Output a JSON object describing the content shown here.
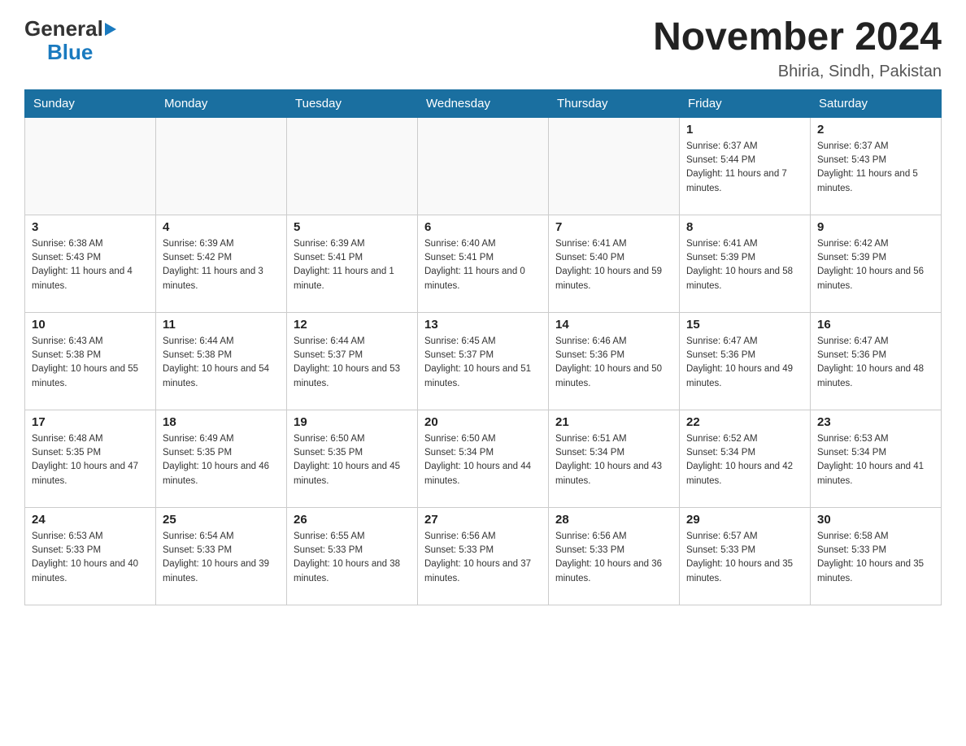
{
  "header": {
    "logo_general": "General",
    "logo_blue": "Blue",
    "month_year": "November 2024",
    "location": "Bhiria, Sindh, Pakistan"
  },
  "days_of_week": [
    "Sunday",
    "Monday",
    "Tuesday",
    "Wednesday",
    "Thursday",
    "Friday",
    "Saturday"
  ],
  "weeks": [
    [
      {
        "day": "",
        "info": ""
      },
      {
        "day": "",
        "info": ""
      },
      {
        "day": "",
        "info": ""
      },
      {
        "day": "",
        "info": ""
      },
      {
        "day": "",
        "info": ""
      },
      {
        "day": "1",
        "info": "Sunrise: 6:37 AM\nSunset: 5:44 PM\nDaylight: 11 hours and 7 minutes."
      },
      {
        "day": "2",
        "info": "Sunrise: 6:37 AM\nSunset: 5:43 PM\nDaylight: 11 hours and 5 minutes."
      }
    ],
    [
      {
        "day": "3",
        "info": "Sunrise: 6:38 AM\nSunset: 5:43 PM\nDaylight: 11 hours and 4 minutes."
      },
      {
        "day": "4",
        "info": "Sunrise: 6:39 AM\nSunset: 5:42 PM\nDaylight: 11 hours and 3 minutes."
      },
      {
        "day": "5",
        "info": "Sunrise: 6:39 AM\nSunset: 5:41 PM\nDaylight: 11 hours and 1 minute."
      },
      {
        "day": "6",
        "info": "Sunrise: 6:40 AM\nSunset: 5:41 PM\nDaylight: 11 hours and 0 minutes."
      },
      {
        "day": "7",
        "info": "Sunrise: 6:41 AM\nSunset: 5:40 PM\nDaylight: 10 hours and 59 minutes."
      },
      {
        "day": "8",
        "info": "Sunrise: 6:41 AM\nSunset: 5:39 PM\nDaylight: 10 hours and 58 minutes."
      },
      {
        "day": "9",
        "info": "Sunrise: 6:42 AM\nSunset: 5:39 PM\nDaylight: 10 hours and 56 minutes."
      }
    ],
    [
      {
        "day": "10",
        "info": "Sunrise: 6:43 AM\nSunset: 5:38 PM\nDaylight: 10 hours and 55 minutes."
      },
      {
        "day": "11",
        "info": "Sunrise: 6:44 AM\nSunset: 5:38 PM\nDaylight: 10 hours and 54 minutes."
      },
      {
        "day": "12",
        "info": "Sunrise: 6:44 AM\nSunset: 5:37 PM\nDaylight: 10 hours and 53 minutes."
      },
      {
        "day": "13",
        "info": "Sunrise: 6:45 AM\nSunset: 5:37 PM\nDaylight: 10 hours and 51 minutes."
      },
      {
        "day": "14",
        "info": "Sunrise: 6:46 AM\nSunset: 5:36 PM\nDaylight: 10 hours and 50 minutes."
      },
      {
        "day": "15",
        "info": "Sunrise: 6:47 AM\nSunset: 5:36 PM\nDaylight: 10 hours and 49 minutes."
      },
      {
        "day": "16",
        "info": "Sunrise: 6:47 AM\nSunset: 5:36 PM\nDaylight: 10 hours and 48 minutes."
      }
    ],
    [
      {
        "day": "17",
        "info": "Sunrise: 6:48 AM\nSunset: 5:35 PM\nDaylight: 10 hours and 47 minutes."
      },
      {
        "day": "18",
        "info": "Sunrise: 6:49 AM\nSunset: 5:35 PM\nDaylight: 10 hours and 46 minutes."
      },
      {
        "day": "19",
        "info": "Sunrise: 6:50 AM\nSunset: 5:35 PM\nDaylight: 10 hours and 45 minutes."
      },
      {
        "day": "20",
        "info": "Sunrise: 6:50 AM\nSunset: 5:34 PM\nDaylight: 10 hours and 44 minutes."
      },
      {
        "day": "21",
        "info": "Sunrise: 6:51 AM\nSunset: 5:34 PM\nDaylight: 10 hours and 43 minutes."
      },
      {
        "day": "22",
        "info": "Sunrise: 6:52 AM\nSunset: 5:34 PM\nDaylight: 10 hours and 42 minutes."
      },
      {
        "day": "23",
        "info": "Sunrise: 6:53 AM\nSunset: 5:34 PM\nDaylight: 10 hours and 41 minutes."
      }
    ],
    [
      {
        "day": "24",
        "info": "Sunrise: 6:53 AM\nSunset: 5:33 PM\nDaylight: 10 hours and 40 minutes."
      },
      {
        "day": "25",
        "info": "Sunrise: 6:54 AM\nSunset: 5:33 PM\nDaylight: 10 hours and 39 minutes."
      },
      {
        "day": "26",
        "info": "Sunrise: 6:55 AM\nSunset: 5:33 PM\nDaylight: 10 hours and 38 minutes."
      },
      {
        "day": "27",
        "info": "Sunrise: 6:56 AM\nSunset: 5:33 PM\nDaylight: 10 hours and 37 minutes."
      },
      {
        "day": "28",
        "info": "Sunrise: 6:56 AM\nSunset: 5:33 PM\nDaylight: 10 hours and 36 minutes."
      },
      {
        "day": "29",
        "info": "Sunrise: 6:57 AM\nSunset: 5:33 PM\nDaylight: 10 hours and 35 minutes."
      },
      {
        "day": "30",
        "info": "Sunrise: 6:58 AM\nSunset: 5:33 PM\nDaylight: 10 hours and 35 minutes."
      }
    ]
  ]
}
